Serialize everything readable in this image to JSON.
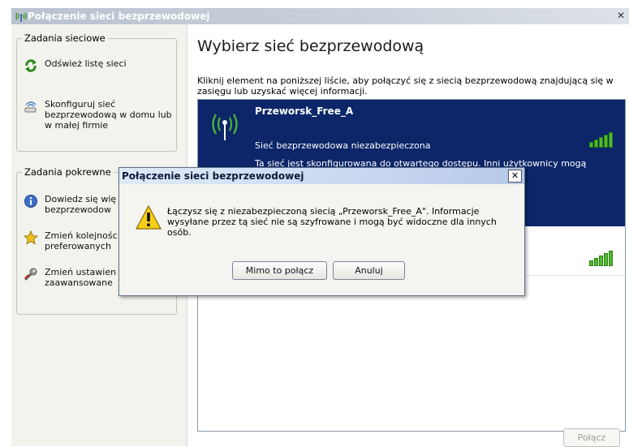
{
  "window": {
    "title": "Połączenie sieci bezprzewodowej",
    "close_glyph": "✕"
  },
  "left_pane": {
    "network_tasks": {
      "title": "Zadania sieciowe",
      "items": [
        {
          "label": "Odśwież listę sieci",
          "icon": "refresh-icon"
        },
        {
          "label": "Skonfiguruj sieć bezprzewodową w domu lub w małej firmie",
          "icon": "wireless-setup-icon"
        }
      ]
    },
    "related_tasks": {
      "title": "Zadania pokrewne",
      "items": [
        {
          "label": "Dowiedz się więcej o sieci bezprzewodowej",
          "visible_label": "Dowiedz się wię bezprzewodow",
          "icon": "info-icon"
        },
        {
          "label": "Zmień kolejność sieci preferowanych",
          "visible_label": "Zmień kolejnośc preferowanych",
          "icon": "star-icon"
        },
        {
          "label": "Zmień ustawienia zaawansowane",
          "visible_label": "Zmień ustawien zaawansowane",
          "icon": "wrench-icon"
        }
      ]
    }
  },
  "main": {
    "heading": "Wybierz sieć bezprzewodową",
    "instruction": "Kliknij element na poniższej liście, aby połączyć się z siecią bezprzewodową znajdującą się w zasięgu lub uzyskać więcej informacji.",
    "networks": [
      {
        "name": "Przeworsk_Free_A",
        "status": "Sieć bezprzewodowa niezabezpieczona",
        "description": "Ta sieć jest skonfigurowana do otwartego dostępu. Inni użytkownicy mogą połączyć z tą siecią,",
        "signal_bars": 5,
        "selected": true
      },
      {
        "name": "",
        "signal_bars": 5,
        "selected": false
      }
    ],
    "connect_button": "Połącz"
  },
  "dialog": {
    "title": "Połączenie sieci bezprzewodowej",
    "close_glyph": "✕",
    "message": "Łączysz się z niezabezpieczoną siecią „Przeworsk_Free_A\". Informacje wysyłane przez tą sieć nie są szyfrowane i mogą być widoczne dla innych osób.",
    "icon": "warning-icon",
    "confirm_button": "Mimo to połącz",
    "cancel_button": "Anuluj"
  },
  "colors": {
    "selected_row": "#0c2669",
    "signal_green": "#4dbd2e"
  }
}
